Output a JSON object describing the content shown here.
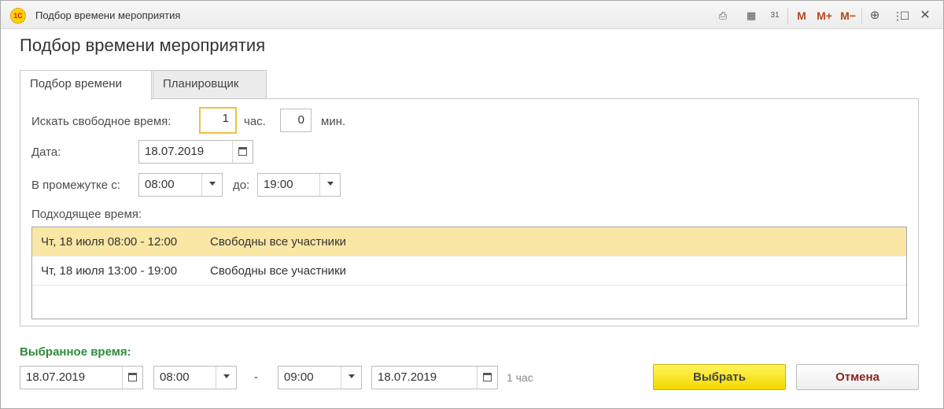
{
  "window": {
    "title": "Подбор времени мероприятия",
    "toolbar": {
      "m_label": "M",
      "m_plus_label": "M+",
      "m_minus_label": "M−",
      "calendar_day": "31"
    }
  },
  "form": {
    "title": "Подбор времени мероприятия",
    "tabs": [
      {
        "label": "Подбор времени",
        "active": true
      },
      {
        "label": "Планировщик",
        "active": false
      }
    ]
  },
  "search": {
    "label": "Искать свободное время:",
    "hours_value": "1",
    "hours_unit": "час.",
    "minutes_value": "0",
    "minutes_unit": "мин.",
    "date_label": "Дата:",
    "date_value": "18.07.2019",
    "range_from_label": "В промежутке с:",
    "range_from_value": "08:00",
    "range_to_label": "до:",
    "range_to_value": "19:00"
  },
  "results": {
    "label": "Подходящее время:",
    "rows": [
      {
        "period": "Чт, 18 июля 08:00 - 12:00",
        "status": "Свободны все участники",
        "selected": true
      },
      {
        "period": "Чт, 18 июля 13:00 - 19:00",
        "status": "Свободны все участники",
        "selected": false
      }
    ]
  },
  "selected_time": {
    "label": "Выбранное время:",
    "start_date": "18.07.2019",
    "start_time": "08:00",
    "separator": "-",
    "end_time": "09:00",
    "end_date": "18.07.2019",
    "duration": "1 час"
  },
  "buttons": {
    "select": "Выбрать",
    "cancel": "Отмена"
  },
  "colors": {
    "selected_row": "#fae7a5",
    "primary_button": "#f5d800",
    "section_label": "#2e8b3c",
    "cancel_text": "#8b2323"
  }
}
